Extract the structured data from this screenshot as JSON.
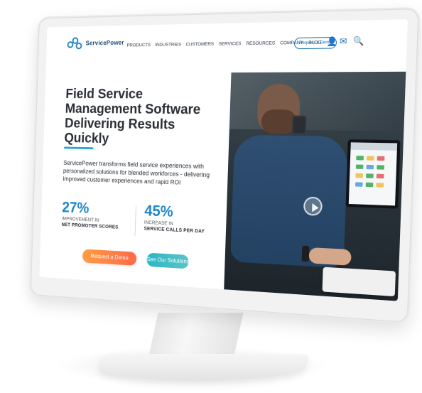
{
  "brand": {
    "name": "ServicePower"
  },
  "nav": {
    "items": [
      "PRODUCTS",
      "INDUSTRIES",
      "CUSTOMERS",
      "SERVICES",
      "RESOURCES",
      "COMPANY",
      "BLOG"
    ],
    "cta": "Request a Demo",
    "icons": [
      "user-icon",
      "mail-icon",
      "search-icon"
    ]
  },
  "hero": {
    "title": "Field Service Management Software Delivering Results Quickly",
    "description": "ServicePower transforms field service experiences with personalized solutions for blended workforces - delivering improved customer experiences and rapid ROI",
    "stats": [
      {
        "value": "27%",
        "caption1": "IMPROVEMENT IN",
        "caption2": "NET PROMOTER SCORES"
      },
      {
        "value": "45%",
        "caption1": "INCREASE IN",
        "caption2": "SERVICE CALLS PER DAY"
      }
    ],
    "buttons": {
      "demo": "Request a Demo",
      "solutions": "See Our Solutions"
    }
  },
  "colors": {
    "brand_blue": "#1c86c9",
    "orange_button": "#ff7b46",
    "teal_button": "#2bb7c4",
    "accent_line": "#2aa6d8"
  },
  "media": {
    "video_play_icon": "play-icon"
  }
}
